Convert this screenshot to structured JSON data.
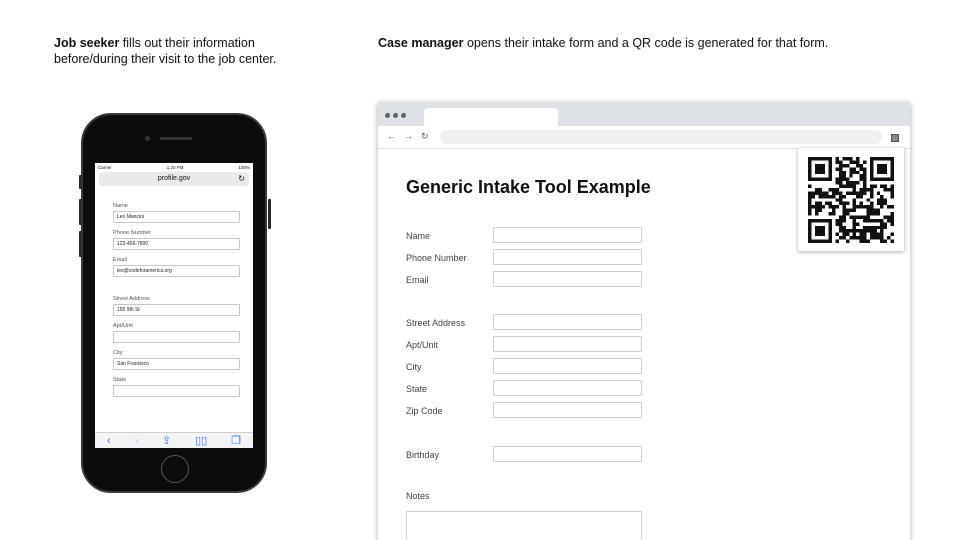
{
  "captions": {
    "left": {
      "bold": "Job seeker",
      "rest": " fills out their information before/during their visit to the job center."
    },
    "right": {
      "bold": "Case manager",
      "rest": " opens their intake form and a QR code is generated for that form."
    }
  },
  "phone": {
    "status": {
      "carrier": "Carrier",
      "time": "1:20 PM",
      "battery": "100%"
    },
    "url": "profile.gov",
    "reload_icon": "↻",
    "fields": [
      {
        "label": "Name",
        "value": "Leo Mancini"
      },
      {
        "label": "Phone Number",
        "value": "123-456-7890"
      },
      {
        "label": "Email",
        "value": "leo@codeforamerica.org"
      },
      {
        "label": "Street Address",
        "value": "155 9th St"
      },
      {
        "label": "Apt/Unit",
        "value": ""
      },
      {
        "label": "City",
        "value": "San Francisco"
      },
      {
        "label": "State",
        "value": ""
      }
    ],
    "tabbar": {
      "back": "‹",
      "forward": "›",
      "share": "⇪",
      "bookmarks": "▯▯",
      "tabs": "❐"
    }
  },
  "browser": {
    "nav": {
      "back": "←",
      "forward": "→",
      "reload": "↻"
    },
    "title": "Generic Intake Tool Example",
    "fields": [
      "Name",
      "Phone Number",
      "Email",
      "Street Address",
      "Apt/Unit",
      "City",
      "State",
      "Zip Code",
      "Birthday"
    ],
    "notes_label": "Notes"
  }
}
